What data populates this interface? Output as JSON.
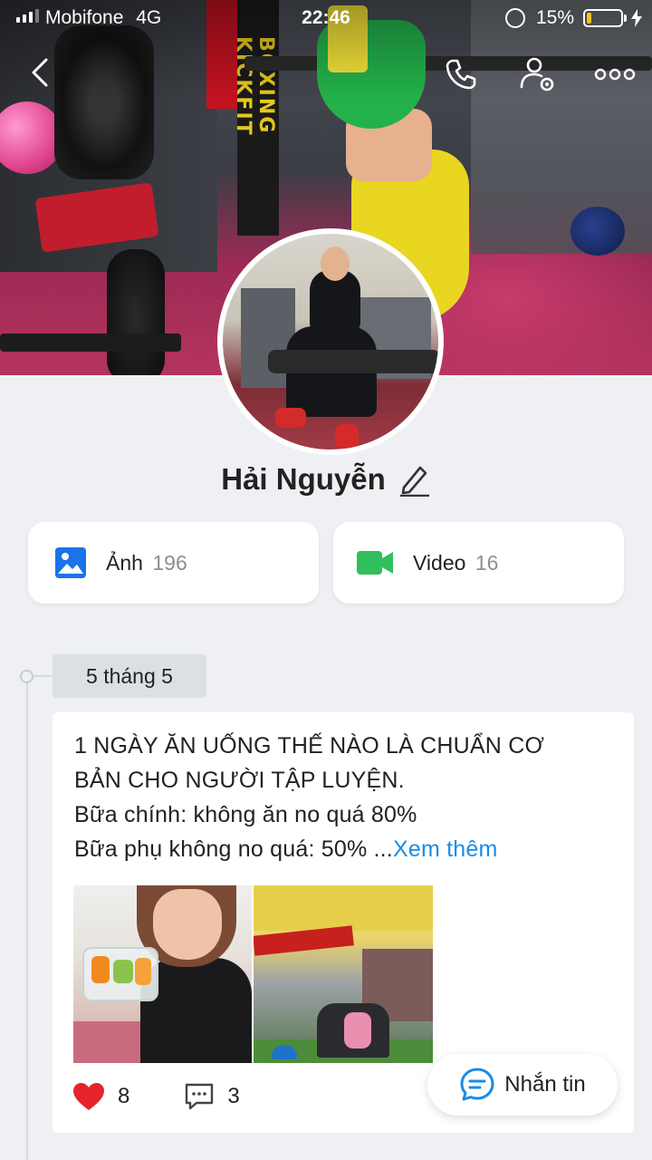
{
  "status_bar": {
    "carrier": "Mobifone",
    "network": "4G",
    "time": "22:46",
    "battery_percent": "15%",
    "battery_level": 0.15
  },
  "cover": {
    "banner_text": "BOXING KICKFIT"
  },
  "top_nav": {
    "back_icon": "back-arrow-icon",
    "call_icon": "phone-icon",
    "settings_icon": "user-settings-icon",
    "more_icon": "more-dots-icon"
  },
  "profile": {
    "name": "Hải Nguyễn",
    "edit_icon": "pencil-icon"
  },
  "media": {
    "photos": {
      "label": "Ảnh",
      "count": "196",
      "icon": "image-icon",
      "color": "#1a73e8"
    },
    "videos": {
      "label": "Video",
      "count": "16",
      "icon": "video-camera-icon",
      "color": "#2fbf5c"
    }
  },
  "timeline": {
    "date": "5 tháng 5",
    "post": {
      "lines": [
        "1 NGÀY ĂN UỐNG THẾ NÀO LÀ CHUẨN CƠ",
        "BẢN CHO NGƯỜI TẬP LUYỆN.",
        "Bữa chính: không ăn no quá 80%",
        "Bữa phụ không no quá: 50% ..."
      ],
      "see_more": "Xem thêm",
      "likes": "8",
      "comments": "3"
    }
  },
  "fab": {
    "label": "Nhắn tin",
    "icon": "chat-bubble-icon",
    "accent": "#1a8ce6"
  }
}
